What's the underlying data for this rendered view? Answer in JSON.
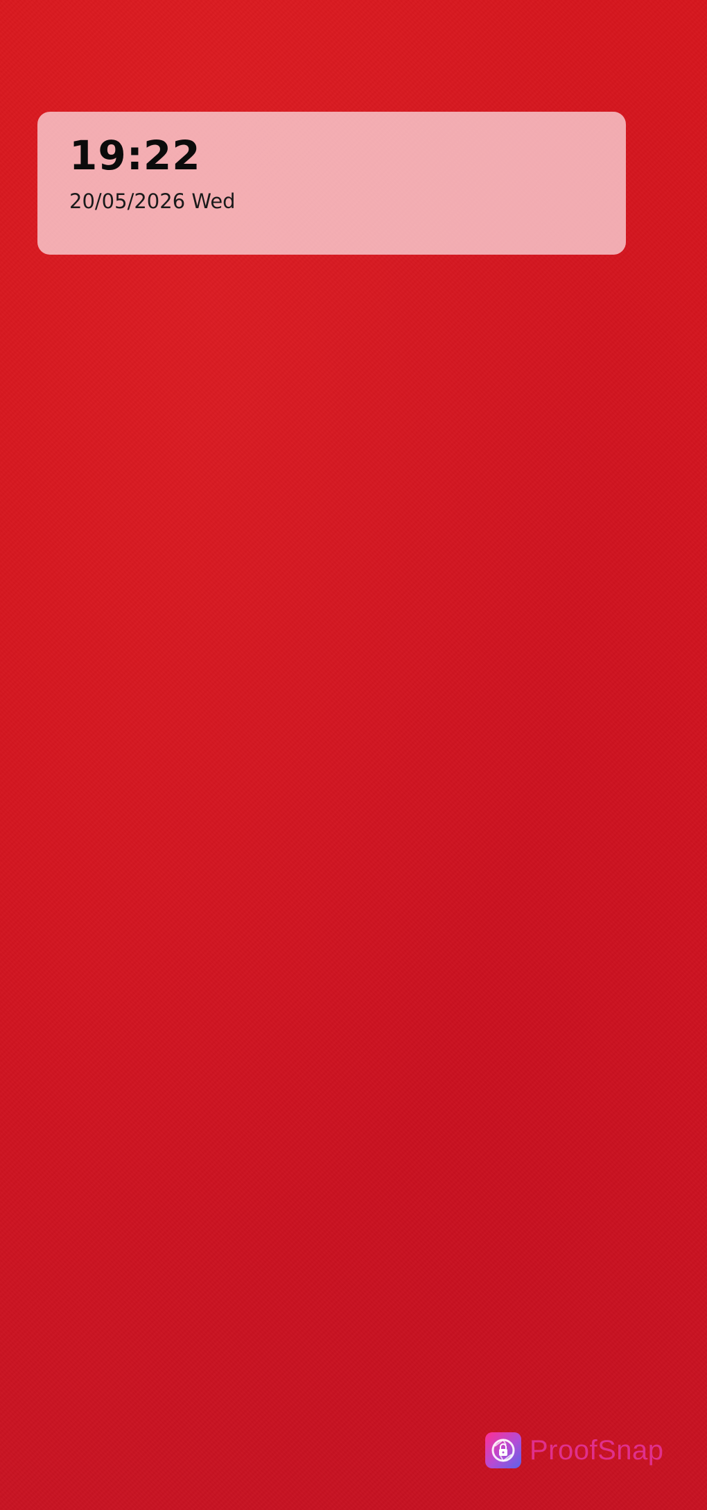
{
  "overlay": {
    "time": "19:22",
    "date": "20/05/2026 Wed"
  },
  "watermark": {
    "brand": "ProofSnap",
    "icon": "proofsnap-lock-icon",
    "brand_color": "#e0308c"
  },
  "colors": {
    "background": "#d4141d",
    "card": "#f2b3b9"
  }
}
